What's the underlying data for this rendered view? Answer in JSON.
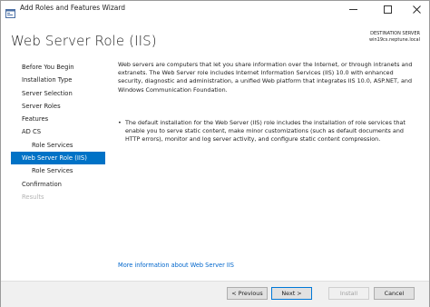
{
  "window": {
    "title": "Add Roles and Features Wizard",
    "controls": {
      "minimize_icon": "minimize-icon",
      "maximize_icon": "maximize-icon",
      "close_icon": "close-icon"
    }
  },
  "header": {
    "title": "Web Server Role (IIS)",
    "destination_label": "DESTINATION SERVER",
    "destination_server": "win19cs.neptune.local"
  },
  "sidebar": {
    "items": [
      {
        "label": "Before You Begin",
        "state": "normal",
        "level": 0
      },
      {
        "label": "Installation Type",
        "state": "normal",
        "level": 0
      },
      {
        "label": "Server Selection",
        "state": "normal",
        "level": 0
      },
      {
        "label": "Server Roles",
        "state": "normal",
        "level": 0
      },
      {
        "label": "Features",
        "state": "normal",
        "level": 0
      },
      {
        "label": "AD CS",
        "state": "normal",
        "level": 0
      },
      {
        "label": "Role Services",
        "state": "normal",
        "level": 1
      },
      {
        "label": "Web Server Role (IIS)",
        "state": "active",
        "level": 0
      },
      {
        "label": "Role Services",
        "state": "normal",
        "level": 1
      },
      {
        "label": "Confirmation",
        "state": "normal",
        "level": 0
      },
      {
        "label": "Results",
        "state": "disabled",
        "level": 0
      }
    ]
  },
  "content": {
    "intro": "Web servers are computers that let you share information over the Internet, or through intranets and extranets. The Web Server role includes Internet Information Services (IIS) 10.0 with enhanced security, diagnostic and administration, a unified Web platform that integrates IIS 10.0, ASP.NET, and Windows Communication Foundation.",
    "bullet_marker": "•",
    "bullet": "The default installation for the Web Server (IIS) role includes the installation of role services that enable you to serve static content, make minor customizations (such as default documents and HTTP errors), monitor and log server activity, and configure static content compression.",
    "more_info_link": "More information about Web Server IIS"
  },
  "footer": {
    "previous_label": "< Previous",
    "next_label": "Next >",
    "install_label": "Install",
    "cancel_label": "Cancel"
  },
  "colors": {
    "accent": "#0072c6",
    "link": "#0066cc",
    "disabled_text": "#b4b4b4"
  }
}
